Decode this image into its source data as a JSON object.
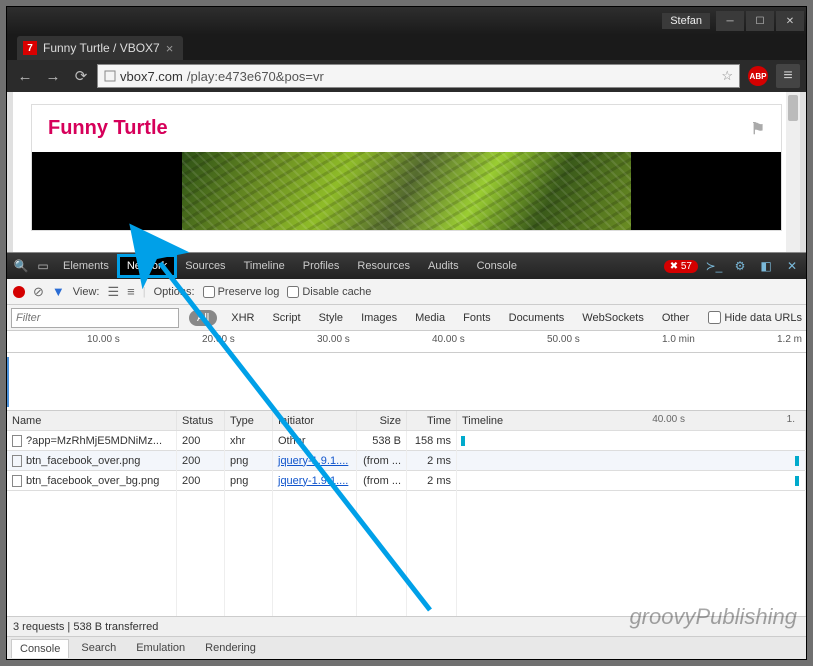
{
  "titlebar": {
    "user": "Stefan"
  },
  "tab": {
    "title": "Funny Turtle / VBOX7"
  },
  "nav": {
    "url_host": "vbox7.com",
    "url_path": "/play:e473e670&pos=vr",
    "abp": "ABP"
  },
  "page": {
    "title": "Funny Turtle"
  },
  "devtools": {
    "tabs": [
      "Elements",
      "Network",
      "Sources",
      "Timeline",
      "Profiles",
      "Resources",
      "Audits",
      "Console"
    ],
    "active_tab": "Network",
    "errors": "57",
    "toolbar": {
      "view_label": "View:",
      "options_label": "Options:",
      "preserve": "Preserve log",
      "disable_cache": "Disable cache"
    },
    "filter": {
      "placeholder": "Filter",
      "types": [
        "All",
        "XHR",
        "Script",
        "Style",
        "Images",
        "Media",
        "Fonts",
        "Documents",
        "WebSockets",
        "Other"
      ],
      "hide_label": "Hide data URLs"
    },
    "ruler": [
      "10.00 s",
      "20.00 s",
      "30.00 s",
      "40.00 s",
      "50.00 s",
      "1.0 min",
      "1.2 m"
    ],
    "columns": {
      "name": "Name",
      "status": "Status",
      "type": "Type",
      "initiator": "Initiator",
      "size": "Size",
      "time": "Time",
      "timeline": "Timeline"
    },
    "tl_ticks": {
      "t1": "40.00 s",
      "t2": "1."
    },
    "rows": [
      {
        "name": "?app=MzRhMjE5MDNiMz...",
        "status": "200",
        "type": "xhr",
        "initiator": "Other",
        "initiator_link": false,
        "size": "538 B",
        "time": "158 ms"
      },
      {
        "name": "btn_facebook_over.png",
        "status": "200",
        "type": "png",
        "initiator": "jquery-1.9.1....",
        "initiator_link": true,
        "size": "(from ...",
        "time": "2 ms"
      },
      {
        "name": "btn_facebook_over_bg.png",
        "status": "200",
        "type": "png",
        "initiator": "jquery-1.9.1....",
        "initiator_link": true,
        "size": "(from ...",
        "time": "2 ms"
      }
    ],
    "status": "3 requests  |  538 B transferred",
    "drawer": [
      "Console",
      "Search",
      "Emulation",
      "Rendering"
    ]
  },
  "watermark": "groovyPublishing"
}
